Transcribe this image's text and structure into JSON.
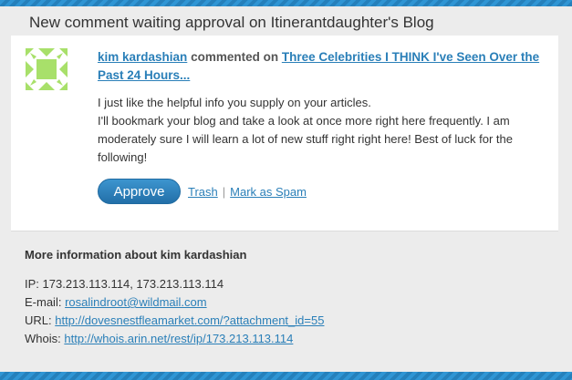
{
  "header": {
    "title": "New comment waiting approval on Itinerantdaughter's Blog"
  },
  "comment": {
    "author": "kim kardashian",
    "verb": "commented on",
    "post_title": "Three Celebrities I THINK I've Seen Over the Past 24 Hours...",
    "paragraph1": "I just like the helpful info you supply on your articles.",
    "paragraph2": "I'll bookmark your blog and take a look at once more right here frequently. I am moderately sure I will learn a lot of new stuff right right here! Best of luck for the following!",
    "avatar_color": "#a8e06a"
  },
  "actions": {
    "approve_label": "Approve",
    "trash_label": "Trash",
    "separator": "|",
    "spam_label": "Mark as Spam"
  },
  "more_info": {
    "title": "More information about kim kardashian",
    "ip_label": "IP:",
    "ip_value": "173.213.113.114, 173.213.113.114",
    "email_label": "E-mail:",
    "email_value": "rosalindroot@wildmail.com",
    "url_label": "URL:",
    "url_value": "http://dovesnestfleamarket.com/?attachment_id=55",
    "whois_label": "Whois:",
    "whois_value": "http://whois.arin.net/rest/ip/173.213.113.114"
  },
  "colors": {
    "accent": "#2a7fb8",
    "stripe": "#2a8bc6",
    "button": "#2a7fb8"
  }
}
